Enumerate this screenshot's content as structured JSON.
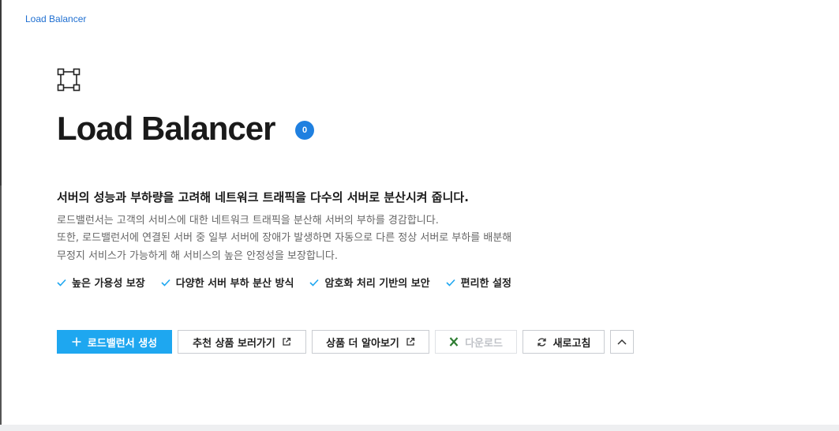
{
  "breadcrumb": "Load Balancer",
  "page": {
    "title": "Load Balancer",
    "count": "0",
    "icon": "load-balancer-icon"
  },
  "intro": {
    "headline": "서버의 성능과 부하량을 고려해 네트워크 트래픽을 다수의 서버로 분산시켜 줍니다.",
    "lines": [
      "로드밸런서는 고객의 서비스에 대한 네트워크 트래픽을 분산해 서버의 부하를 경감합니다.",
      "또한, 로드밸런서에 연결된 서버 중 일부 서버에 장애가 발생하면 자동으로 다른 정상 서버로 부하를 배분해",
      "무정지 서비스가 가능하게 해 서비스의 높은 안정성을 보장합니다."
    ]
  },
  "features": [
    "높은 가용성 보장",
    "다양한 서버 부하 분산 방식",
    "암호화 처리 기반의 보안",
    "편리한 설정"
  ],
  "toolbar": {
    "create_label": "로드밸런서 생성",
    "recommend_label": "추천 상품 보러가기",
    "learn_more_label": "상품 더 알아보기",
    "download_label": "다운로드",
    "refresh_label": "새로고침"
  },
  "colors": {
    "accent": "#1ea7f0",
    "badge": "#1f80e0",
    "link": "#1f6fd1",
    "check": "#1ea7f0",
    "excel": "#2e7d32"
  }
}
